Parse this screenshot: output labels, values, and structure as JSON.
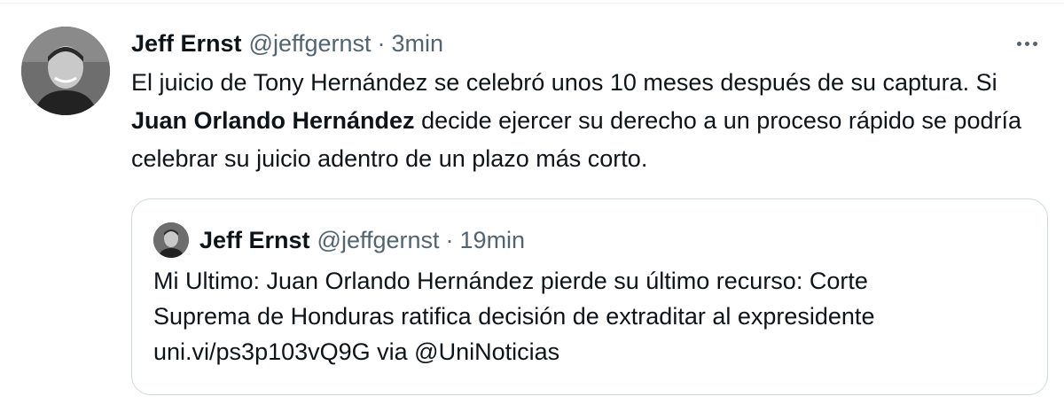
{
  "tweet": {
    "author_name": "Jeff Ernst",
    "author_handle": "@jeffgernst",
    "separator": "·",
    "time": "3min",
    "more_icon": "more-horizontal-icon",
    "text_before": "El juicio de Tony Hernández se celebró unos 10 meses después de su captura. Si ",
    "text_bold": "Juan Orlando Hernández",
    "text_after": " decide ejercer su derecho a un proceso rápido se podría celebrar su juicio adentro de un plazo más corto."
  },
  "quoted": {
    "author_name": "Jeff Ernst",
    "author_handle": "@jeffgernst",
    "separator": "·",
    "time": "19min",
    "line1": "Mi Ultimo: Juan Orlando Hernández pierde su último recurso: Corte",
    "line2": "Suprema de Honduras ratifica decisión de extraditar al expresidente",
    "line3": "uni.vi/ps3p103vQ9G via @UniNoticias"
  },
  "colors": {
    "primary_text": "#0f1419",
    "secondary_text": "#536471",
    "border": "#cfd9de"
  }
}
